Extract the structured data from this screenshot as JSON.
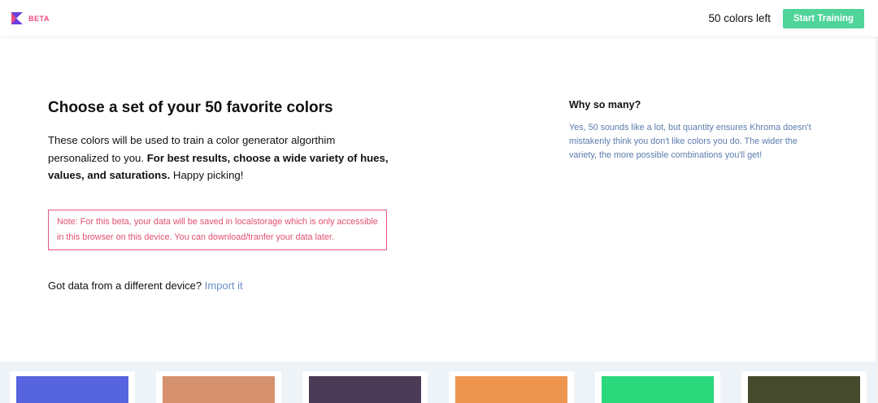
{
  "header": {
    "beta_label": "BETA",
    "logo_color": "#6b3fe0",
    "logo_accent": "#e84b82",
    "colors_left": "50 colors left",
    "start_button": "Start Training",
    "start_button_color": "#4fd49a"
  },
  "main": {
    "title": "Choose a set of your 50 favorite colors",
    "intro_text": "These colors will be used to train a color generator algorthim personalized to you. ",
    "intro_bold": "For best results, choose a wide variety of hues, values, and saturations.",
    "intro_tail": " Happy picking!",
    "note": "Note: For this beta, your data will be saved in localstorage which is only accessible in this browser on this device. You can download/tranfer your data later.",
    "import_prompt": "Got data from a different device? ",
    "import_link": "Import it"
  },
  "sidebar": {
    "title": "Why so many?",
    "text": "Yes, 50 sounds like a lot, but quantity ensures Khroma doesn't mistakenly think you don't like colors you do. The wider the variety, the more possible combinations you'll get!"
  },
  "swatches": [
    {
      "color": "#5764e0"
    },
    {
      "color": "#d6916e"
    },
    {
      "color": "#4a3b57"
    },
    {
      "color": "#ee9650"
    },
    {
      "color": "#2bd87c"
    },
    {
      "color": "#454a2d"
    }
  ]
}
